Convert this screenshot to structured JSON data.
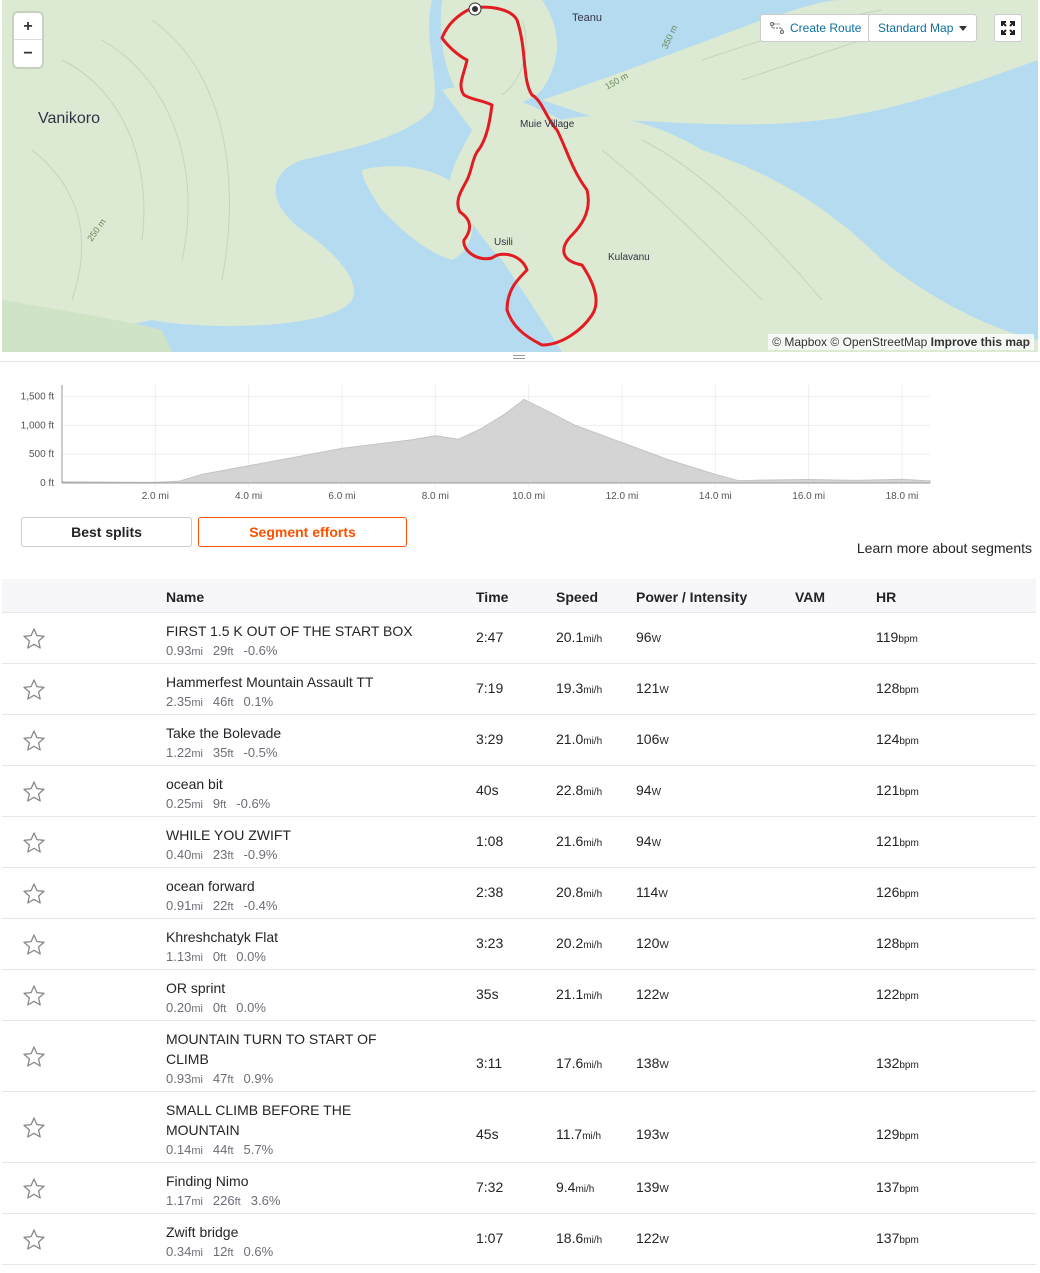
{
  "map": {
    "zoom_in": "+",
    "zoom_out": "−",
    "create_route": "Create Route",
    "standard_map": "Standard Map",
    "labels": {
      "vanikoro": "Vanikoro",
      "teanu": "Teanu",
      "muie_village": "Muie Village",
      "usili": "Usili",
      "kulavanu": "Kulavanu",
      "c350": "350 m",
      "c150": "150 m",
      "c250": "250 m"
    },
    "attribution_mapbox": "© Mapbox",
    "attribution_osm": "© OpenStreetMap",
    "attribution_improve": "Improve this map",
    "colors": {
      "water": "#b4dbef",
      "land": "#dcead4",
      "route": "#e31c23"
    }
  },
  "elevation": {
    "y_ticks": [
      "1,500 ft",
      "1,000 ft",
      "500 ft",
      "0 ft"
    ],
    "x_ticks": [
      "2.0 mi",
      "4.0 mi",
      "6.0 mi",
      "8.0 mi",
      "10.0 mi",
      "12.0 mi",
      "14.0 mi",
      "16.0 mi",
      "18.0 mi"
    ],
    "profile_ft": [
      [
        0,
        20
      ],
      [
        1,
        15
      ],
      [
        2,
        10
      ],
      [
        2.5,
        30
      ],
      [
        3,
        150
      ],
      [
        4,
        300
      ],
      [
        5,
        450
      ],
      [
        6,
        600
      ],
      [
        7,
        700
      ],
      [
        7.5,
        750
      ],
      [
        8,
        820
      ],
      [
        8.5,
        760
      ],
      [
        9,
        950
      ],
      [
        9.5,
        1200
      ],
      [
        9.9,
        1450
      ],
      [
        10.4,
        1250
      ],
      [
        11,
        1000
      ],
      [
        12,
        700
      ],
      [
        13,
        400
      ],
      [
        14,
        150
      ],
      [
        14.5,
        40
      ],
      [
        15,
        50
      ],
      [
        16,
        60
      ],
      [
        17,
        45
      ],
      [
        18,
        65
      ],
      [
        18.5,
        40
      ]
    ],
    "max_mi": 18.6,
    "max_ft": 1700
  },
  "tabs": {
    "best_splits": "Best splits",
    "segment_efforts": "Segment efforts"
  },
  "learn_more": "Learn more about segments",
  "table": {
    "headers": {
      "name": "Name",
      "time": "Time",
      "speed": "Speed",
      "power": "Power / Intensity",
      "vam": "VAM",
      "hr": "HR"
    },
    "rows": [
      {
        "name": "FIRST 1.5 K OUT OF THE START BOX",
        "dist": "0.93",
        "elev": "29",
        "grade": "-0.6%",
        "time": "2:47",
        "speed": "20.1",
        "power": "96",
        "hr": "119"
      },
      {
        "name": "Hammerfest Mountain Assault TT",
        "dist": "2.35",
        "elev": "46",
        "grade": "0.1%",
        "time": "7:19",
        "speed": "19.3",
        "power": "121",
        "hr": "128"
      },
      {
        "name": "Take the Bolevade",
        "dist": "1.22",
        "elev": "35",
        "grade": "-0.5%",
        "time": "3:29",
        "speed": "21.0",
        "power": "106",
        "hr": "124"
      },
      {
        "name": "ocean bit",
        "dist": "0.25",
        "elev": "9",
        "grade": "-0.6%",
        "time": "40s",
        "speed": "22.8",
        "power": "94",
        "hr": "121"
      },
      {
        "name": "WHILE YOU ZWIFT",
        "dist": "0.40",
        "elev": "23",
        "grade": "-0.9%",
        "time": "1:08",
        "speed": "21.6",
        "power": "94",
        "hr": "121"
      },
      {
        "name": "ocean forward",
        "dist": "0.91",
        "elev": "22",
        "grade": "-0.4%",
        "time": "2:38",
        "speed": "20.8",
        "power": "114",
        "hr": "126"
      },
      {
        "name": "Khreshchatyk Flat",
        "dist": "1.13",
        "elev": "0",
        "grade": "0.0%",
        "time": "3:23",
        "speed": "20.2",
        "power": "120",
        "hr": "128"
      },
      {
        "name": "OR sprint",
        "dist": "0.20",
        "elev": "0",
        "grade": "0.0%",
        "time": "35s",
        "speed": "21.1",
        "power": "122",
        "hr": "122"
      },
      {
        "name": "MOUNTAIN TURN TO START OF CLIMB",
        "dist": "0.93",
        "elev": "47",
        "grade": "0.9%",
        "time": "3:11",
        "speed": "17.6",
        "power": "138",
        "hr": "132"
      },
      {
        "name": "SMALL CLIMB BEFORE THE MOUNTAIN",
        "dist": "0.14",
        "elev": "44",
        "grade": "5.7%",
        "time": "45s",
        "speed": "11.7",
        "power": "193",
        "hr": "129"
      },
      {
        "name": "Finding Nimo",
        "dist": "1.17",
        "elev": "226",
        "grade": "3.6%",
        "time": "7:32",
        "speed": "9.4",
        "power": "139",
        "hr": "137"
      },
      {
        "name": "Zwift bridge",
        "dist": "0.34",
        "elev": "12",
        "grade": "0.6%",
        "time": "1:07",
        "speed": "18.6",
        "power": "122",
        "hr": "137"
      }
    ],
    "units": {
      "dist": "mi",
      "elev": "ft",
      "speed": "mi/h",
      "power": "W",
      "hr": "bpm"
    }
  }
}
